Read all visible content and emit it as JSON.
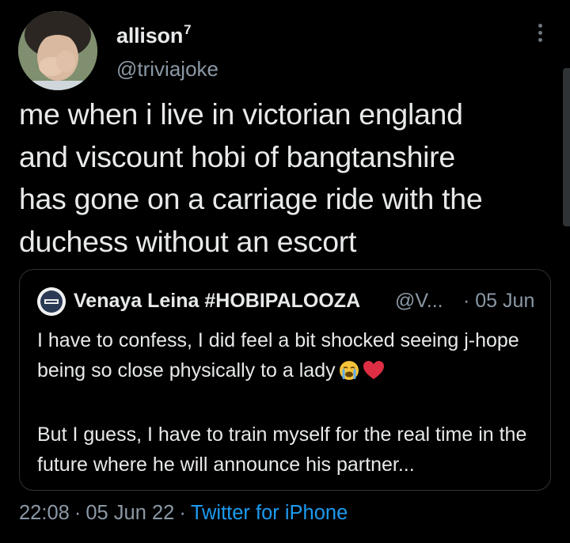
{
  "author": {
    "display_name": "allison",
    "name_superscript": "7",
    "handle": "@triviajoke"
  },
  "tweet": {
    "text": "me when i live in victorian england\nand viscount hobi of bangtanshire\nhas gone on a carriage ride with the\nduchess without an escort"
  },
  "quote": {
    "name": "Venaya Leina #HOBIPALOOZA",
    "handle": "@V...",
    "separator": "·",
    "date": "05 Jun",
    "paragraph1": "I have to confess, I did feel a bit shocked seeing j-hope being so close physically to a lady",
    "paragraph2": "But I guess, I have to train myself for the real time in the future where he will announce his partner...",
    "emojis": [
      "loudly-crying-face",
      "red-heart"
    ]
  },
  "meta": {
    "time": "22:08",
    "separator": "·",
    "date": "05 Jun 22",
    "source": "Twitter for iPhone"
  },
  "colors": {
    "background": "#000000",
    "primary_text": "#e7e9ea",
    "secondary_text": "#8b98a5",
    "link": "#1d9bf0",
    "border": "#2f3336"
  }
}
